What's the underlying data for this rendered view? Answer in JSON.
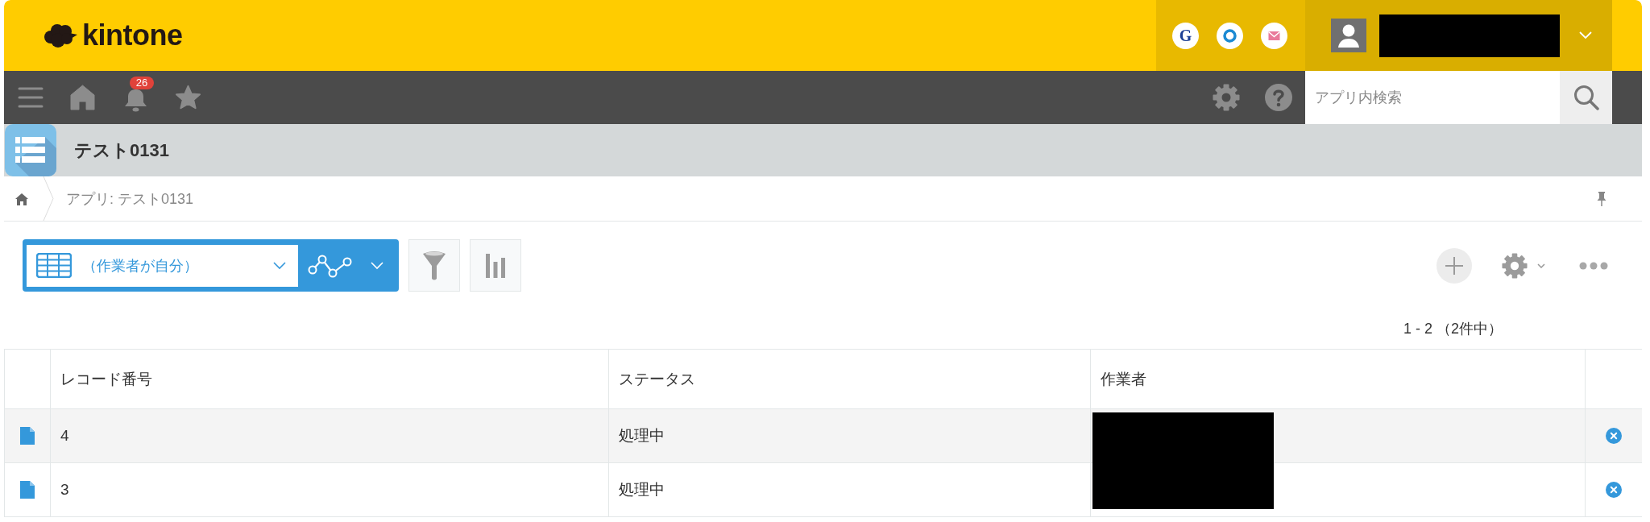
{
  "header": {
    "logo": "kintone",
    "shortcuts": [
      {
        "kind": "letter",
        "label": "G"
      },
      {
        "kind": "ring"
      },
      {
        "kind": "mail"
      }
    ]
  },
  "navbar": {
    "notifications": "26",
    "search": {
      "placeholder": "アプリ内検索"
    }
  },
  "app_bar": {
    "title": "テスト0131"
  },
  "breadcrumb": {
    "items": [
      "アプリ: テスト0131"
    ]
  },
  "toolbar": {
    "view": "（作業者が自分）",
    "record_count": "1 - 2 （2件中）"
  },
  "table": {
    "columns": [
      "レコード番号",
      "ステータス",
      "作業者"
    ],
    "rows": [
      {
        "cells": [
          "4",
          "処理中"
        ]
      },
      {
        "cells": [
          "3",
          "処理中"
        ]
      }
    ]
  }
}
